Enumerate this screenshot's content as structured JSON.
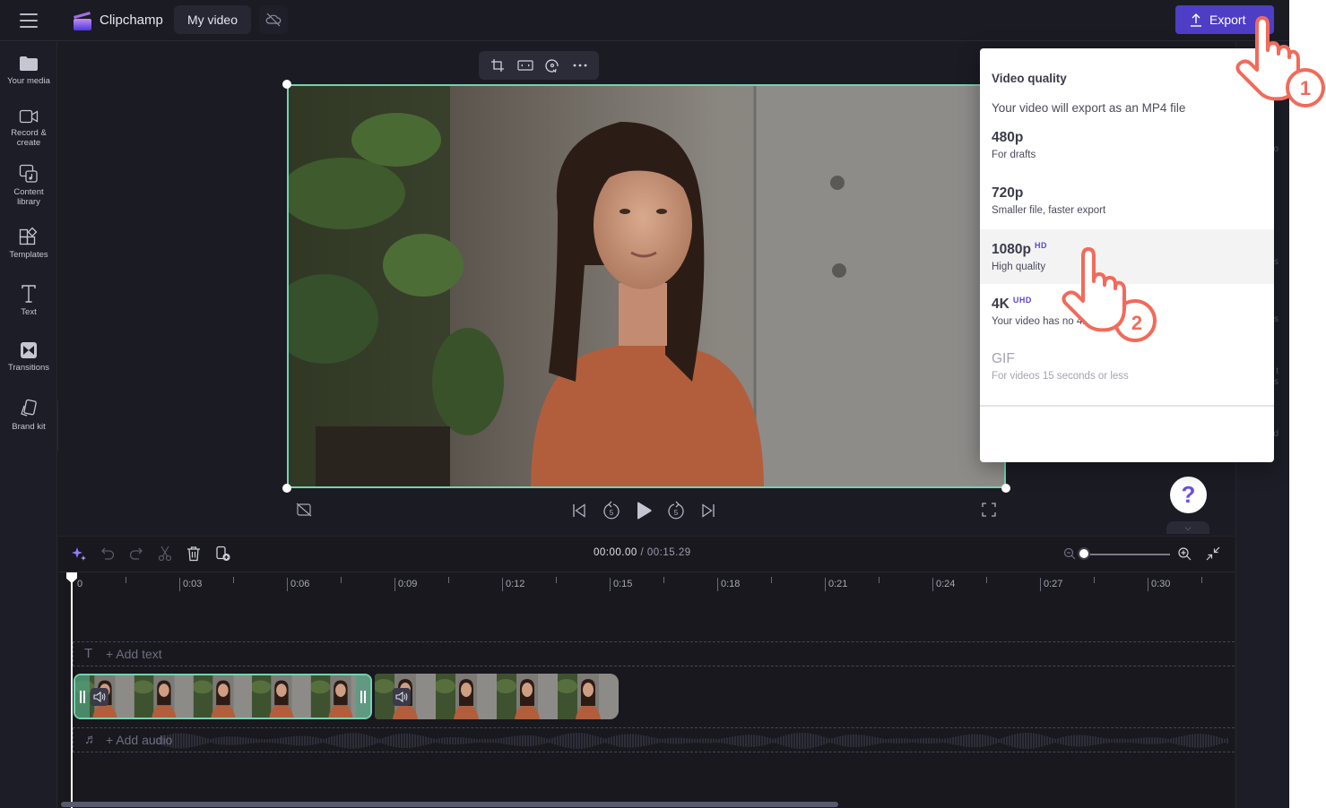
{
  "topbar": {
    "menu_icon": "hamburger-menu-icon",
    "brand_name": "Clipchamp",
    "project_title": "My video",
    "cloud_status_icon": "cloud-off-icon",
    "export_label": "Export",
    "export_icon": "upload-icon"
  },
  "sidebar": {
    "items": [
      {
        "label": "Your media",
        "icon": "folder-icon"
      },
      {
        "label": "Record & create",
        "icon": "video-camera-icon"
      },
      {
        "label": "Content library",
        "icon": "content-library-icon"
      },
      {
        "label": "Templates",
        "icon": "templates-icon"
      },
      {
        "label": "Text",
        "icon": "text-icon"
      },
      {
        "label": "Transitions",
        "icon": "transitions-icon"
      },
      {
        "label": "Brand kit",
        "icon": "brand-kit-icon"
      }
    ],
    "expand_icon": "chevron-right-icon"
  },
  "preview": {
    "context_toolbar": [
      "crop-icon",
      "fit-icon",
      "rotate-icon",
      "more-icon"
    ],
    "playback_controls": [
      "captions-off-icon",
      "skip-back-icon",
      "rewind-5-icon",
      "play-icon",
      "forward-5-icon",
      "skip-forward-icon",
      "fullscreen-icon"
    ],
    "rewind_seconds": "5",
    "forward_seconds": "5"
  },
  "export_menu": {
    "title": "Video quality",
    "subtitle": "Your video will export as an MP4 file",
    "options": [
      {
        "name": "480p",
        "badge": "",
        "description": "For drafts",
        "disabled": false,
        "highlighted": false
      },
      {
        "name": "720p",
        "badge": "",
        "description": "Smaller file, faster export",
        "disabled": false,
        "highlighted": false
      },
      {
        "name": "1080p",
        "badge": "HD",
        "description": "High quality",
        "disabled": false,
        "highlighted": true
      },
      {
        "name": "4K",
        "badge": "UHD",
        "description": "Your video has no 4K media",
        "disabled": false,
        "highlighted": false
      },
      {
        "name": "GIF",
        "badge": "",
        "description": "For videos 15 seconds or less",
        "disabled": true,
        "highlighted": false
      }
    ]
  },
  "annotations": {
    "step1": "1",
    "step2": "2"
  },
  "help": {
    "help_label": "?"
  },
  "timeline": {
    "toolbar_icons": [
      "magic-icon",
      "undo-icon",
      "redo-icon",
      "split-icon",
      "delete-icon",
      "add-media-icon"
    ],
    "current_time": "00:00.00",
    "separator": "/",
    "total_time": "00:15.29",
    "zoom_level": 0.0,
    "ruler_labels": [
      "0",
      "0:03",
      "0:06",
      "0:09",
      "0:12",
      "0:15",
      "0:18",
      "0:21",
      "0:24",
      "0:27",
      "0:30"
    ],
    "add_text_label": "+ Add text",
    "add_audio_label": "+ Add audio",
    "clips": [
      {
        "name": "clip-1",
        "selected": true
      },
      {
        "name": "clip-2",
        "selected": false
      }
    ]
  },
  "colors": {
    "accent": "#4e3ec5",
    "selection": "#74d3ae",
    "badge": "#5b46d6",
    "annotation": "#f26a5a"
  }
}
